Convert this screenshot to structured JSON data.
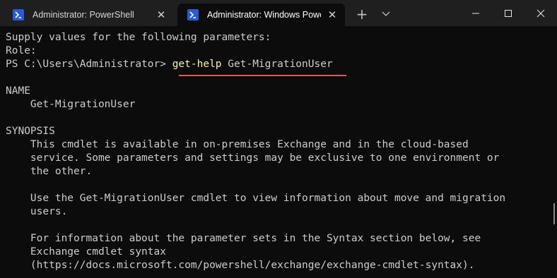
{
  "tabs": [
    {
      "label": "Administrator: PowerShell",
      "active": false
    },
    {
      "label": "Administrator: Windows PowerShell",
      "active": true
    }
  ],
  "titlebar": {
    "new_tab_icon": "plus-icon",
    "dropdown_icon": "chevron-down-icon",
    "minimize_icon": "minimize-icon",
    "maximize_icon": "maximize-icon",
    "close_icon": "close-icon"
  },
  "colors": {
    "background": "#0c0c0c",
    "titlebar": "#1f1f1f",
    "text": "#cccccc",
    "command_highlight": "#f9f1a5",
    "annotation_underline": "#e05a5a"
  },
  "console": {
    "prompt_intro": "Supply values for the following parameters:",
    "role_prompt": "Role:",
    "prompt": "PS C:\\Users\\Administrator> ",
    "command_verb": "get-help",
    "command_arg": " Get-MigrationUser",
    "name_header": "NAME",
    "name_value": "    Get-MigrationUser",
    "synopsis_header": "SYNOPSIS",
    "synopsis_lines": [
      "    This cmdlet is available in on-premises Exchange and in the cloud-based",
      "    service. Some parameters and settings may be exclusive to one environment or",
      "    the other.",
      "",
      "    Use the Get-MigrationUser cmdlet to view information about move and migration",
      "    users.",
      "",
      "    For information about the parameter sets in the Syntax section below, see",
      "    Exchange cmdlet syntax",
      "    (https://docs.microsoft.com/powershell/exchange/exchange-cmdlet-syntax)."
    ]
  }
}
